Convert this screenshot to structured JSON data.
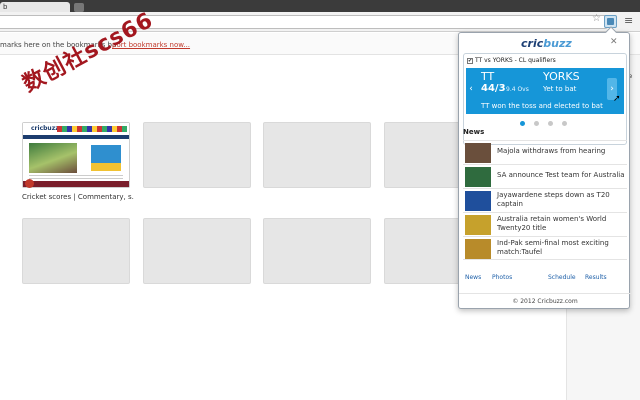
{
  "browser": {
    "tab_label": "b"
  },
  "bookmarks_bar": {
    "text": "marks here on the bookmarks ba",
    "link": "port bookmarks now..."
  },
  "watermark": "数创社scs66",
  "new_tab": {
    "most_visited": [
      {
        "title": "Cricket scores | Commentary, s...",
        "has_thumbnail": true
      },
      {
        "title": "",
        "has_thumbnail": false
      },
      {
        "title": "",
        "has_thumbnail": false
      },
      {
        "title": "",
        "has_thumbnail": false
      },
      {
        "title": "",
        "has_thumbnail": false
      },
      {
        "title": "",
        "has_thumbnail": false
      },
      {
        "title": "",
        "has_thumbnail": false
      },
      {
        "title": "",
        "has_thumbnail": false
      }
    ],
    "thumbnail_logo": "cricbuzz"
  },
  "right_window": {
    "text_line1": "r",
    "text_line2": "ome",
    "text_line3": "n"
  },
  "popup": {
    "brand_prefix": "cric",
    "brand_suffix": "buzz",
    "match": {
      "checkbox_mark": "✔",
      "title": "TT vs YORKS - CL qualifiers",
      "team1": "TT",
      "score1": "44/3",
      "overs": "9.4 Ovs",
      "team2": "YORKS",
      "team2_status": "Yet to bat",
      "toss": "TT won the toss and elected to bat",
      "slide_count": 4,
      "active_slide": 1
    },
    "news_heading": "News",
    "news": [
      {
        "headline": "Majola withdraws from hearing",
        "thumb_color": "#6a4f3c"
      },
      {
        "headline": "SA announce Test team for Australia",
        "thumb_color": "#2f6b3e"
      },
      {
        "headline": "Jayawardene steps down as T20 captain",
        "thumb_color": "#1f4f9c"
      },
      {
        "headline": "Australia retain women's World Twenty20 title",
        "thumb_color": "#c6a12c"
      },
      {
        "headline": "Ind-Pak semi-final most exciting match:Taufel",
        "thumb_color": "#b88b2a"
      }
    ],
    "links": {
      "news": "News",
      "photos": "Photos",
      "schedule": "Schedule",
      "results": "Results"
    },
    "copyright": "© 2012 Cricbuzz.com",
    "colors": {
      "brand_blue": "#1d3f74",
      "panel_blue": "#1696d8"
    }
  }
}
